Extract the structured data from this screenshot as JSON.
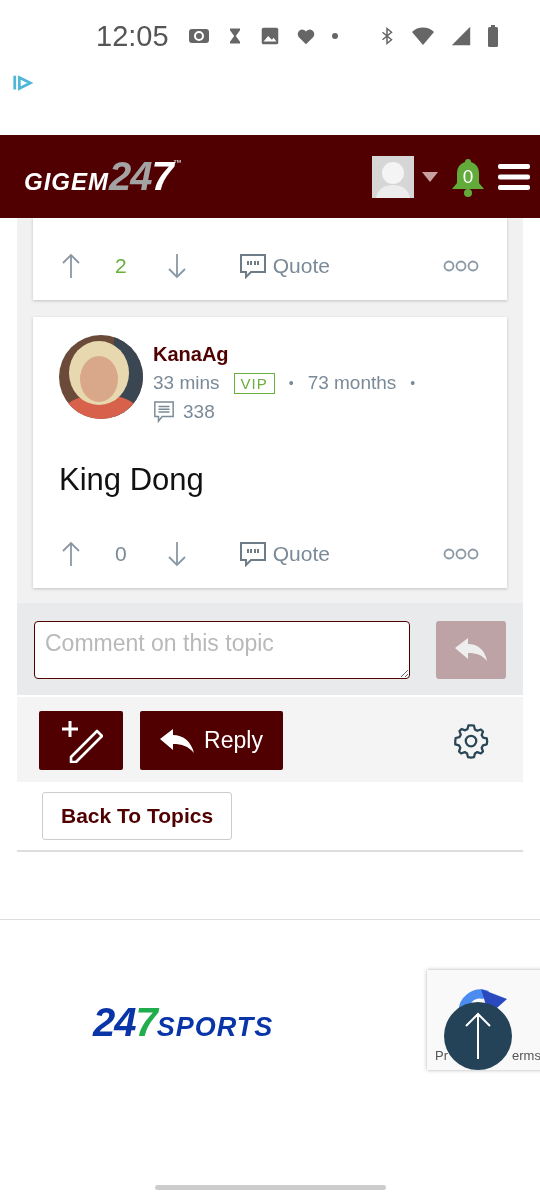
{
  "status_bar": {
    "time": "12:05"
  },
  "header": {
    "logo_parts": [
      {
        "text": "GIGEM",
        "color": "#ffffff"
      },
      {
        "text": "24",
        "color": "#a3a3a3"
      },
      {
        "text": "7",
        "color": "#ffffff"
      }
    ],
    "trademark": "™",
    "notifications": "0"
  },
  "posts": [
    {
      "kind": "partial",
      "score": "2",
      "color": "#6aae3c",
      "quote": "Quote"
    },
    {
      "kind": "full",
      "author": "KanaAg",
      "time": "33 mins",
      "badge": "VIP",
      "separators": [
        "•",
        "•"
      ],
      "tenure": "73 months",
      "post_count": "338",
      "body": "King Dong",
      "score": "0",
      "color": "#7b8a97",
      "quote": "Quote"
    }
  ],
  "comment": {
    "placeholder": "Comment on this topic"
  },
  "actions": {
    "reply": "Reply",
    "back": "Back To Topics"
  },
  "footer": {
    "logo_parts": [
      {
        "text": "24",
        "color": "#0a35a8"
      },
      {
        "text": "7",
        "color": "#1fae4b"
      },
      {
        "text": "SPORTS",
        "color": "#0a35a8"
      }
    ]
  },
  "recaptcha": {
    "texts": [
      "Pr",
      "erms"
    ]
  }
}
